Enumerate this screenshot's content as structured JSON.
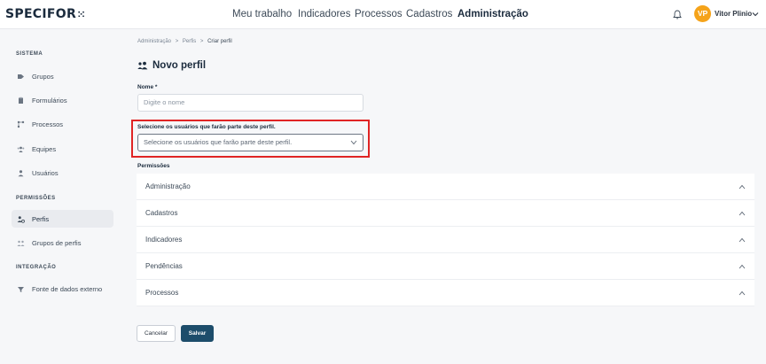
{
  "header": {
    "logo": "SPECIFOR",
    "logo_mark": "⁙",
    "nav": [
      "Meu trabalho",
      "Indicadores",
      "Processos",
      "Cadastros",
      "Administração"
    ],
    "active_nav": "Administração",
    "user_initials": "VP",
    "user_name": "Vitor Plinio",
    "avatar_color": "#f5a31a"
  },
  "sidebar": {
    "sections": [
      {
        "title": "SISTEMA",
        "items": [
          "Grupos",
          "Formulários",
          "Processos",
          "Equipes",
          "Usuários"
        ]
      },
      {
        "title": "PERMISSÕES",
        "items": [
          "Perfis",
          "Grupos de perfis"
        ]
      },
      {
        "title": "INTEGRAÇÃO",
        "items": [
          "Fonte de dados externo"
        ]
      }
    ],
    "active_item": "Perfis"
  },
  "breadcrumb": [
    "Administração",
    ">",
    "Perfis",
    ">",
    "Criar perfil"
  ],
  "page_title": "Novo perfil",
  "form": {
    "name_label": "Nome *",
    "name_placeholder": "Digite o nome",
    "users_label": "Selecione os usuários que farão parte deste perfil.",
    "users_placeholder": "Selecione os usuários que farão parte deste perfil.",
    "permissions_label": "Permissões",
    "permissions": [
      "Administração",
      "Cadastros",
      "Indicadores",
      "Pendências",
      "Processos"
    ]
  },
  "buttons": {
    "cancel": "Cancelar",
    "save": "Salvar"
  },
  "colors": {
    "primary": "#1d4d6b",
    "highlight": "#e02424"
  }
}
